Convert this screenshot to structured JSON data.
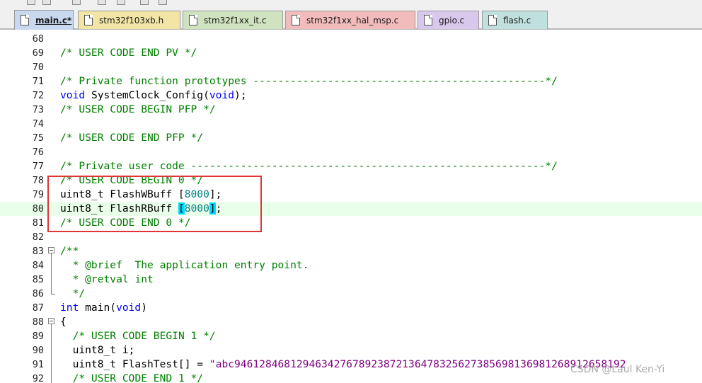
{
  "colors": {
    "comment": "#008000",
    "keyword": "#0000ff",
    "number": "#008080",
    "string": "#800080",
    "bracket_match": "#00d9ff",
    "current_line": "#e9ffe9",
    "annotation_box": "#e03535"
  },
  "tabs": [
    {
      "label": "main.c*",
      "color": "#c8d8ef",
      "active": true,
      "icon": "file-icon"
    },
    {
      "label": "stm32f103xb.h",
      "color": "#f2e5a6",
      "active": false,
      "icon": "file-icon"
    },
    {
      "label": "stm32f1xx_it.c",
      "color": "#cfe3bf",
      "active": false,
      "icon": "file-icon"
    },
    {
      "label": "stm32f1xx_hal_msp.c",
      "color": "#f2bcbc",
      "active": false,
      "icon": "file-icon"
    },
    {
      "label": "gpio.c",
      "color": "#d7c8ec",
      "active": false,
      "icon": "file-icon"
    },
    {
      "label": "flash.c",
      "color": "#bfe0dc",
      "active": false,
      "icon": "file-icon"
    }
  ],
  "editor": {
    "current_line": 80,
    "lines": [
      {
        "num": "68",
        "text": ""
      },
      {
        "num": "69",
        "text": "/* USER CODE END PV */"
      },
      {
        "num": "70",
        "text": ""
      },
      {
        "num": "71",
        "text": "/* Private function prototypes -----------------------------------------------*/"
      },
      {
        "num": "72",
        "text": "void SystemClock_Config(void);"
      },
      {
        "num": "73",
        "text": "/* USER CODE BEGIN PFP */"
      },
      {
        "num": "74",
        "text": ""
      },
      {
        "num": "75",
        "text": "/* USER CODE END PFP */"
      },
      {
        "num": "76",
        "text": ""
      },
      {
        "num": "77",
        "text": "/* Private user code ---------------------------------------------------------*/"
      },
      {
        "num": "78",
        "text": "/* USER CODE BEGIN 0 */"
      },
      {
        "num": "79",
        "text": "uint8_t FlashWBuff [8000];"
      },
      {
        "num": "80",
        "text": "uint8_t FlashRBuff [8000];"
      },
      {
        "num": "81",
        "text": "/* USER CODE END 0 */"
      },
      {
        "num": "82",
        "text": ""
      },
      {
        "num": "83",
        "text": "/**",
        "fold": "open"
      },
      {
        "num": "84",
        "text": "  * @brief  The application entry point.",
        "fold": "line"
      },
      {
        "num": "85",
        "text": "  * @retval int",
        "fold": "line"
      },
      {
        "num": "86",
        "text": "  */",
        "fold": "end"
      },
      {
        "num": "87",
        "text": "int main(void)"
      },
      {
        "num": "88",
        "text": "{",
        "fold": "open"
      },
      {
        "num": "89",
        "text": "  /* USER CODE BEGIN 1 */",
        "fold": "line"
      },
      {
        "num": "90",
        "text": "  uint8_t i;",
        "fold": "line"
      },
      {
        "num": "91",
        "text": "  uint8_t FlashTest[] = \"abc946128468129463427678923872136478325627385698136981268912658192",
        "fold": "line"
      },
      {
        "num": "92",
        "text": "  /* USER CODE END 1 */",
        "fold": "line"
      }
    ]
  },
  "watermark": "CSDN @Laul Ken-Yi"
}
